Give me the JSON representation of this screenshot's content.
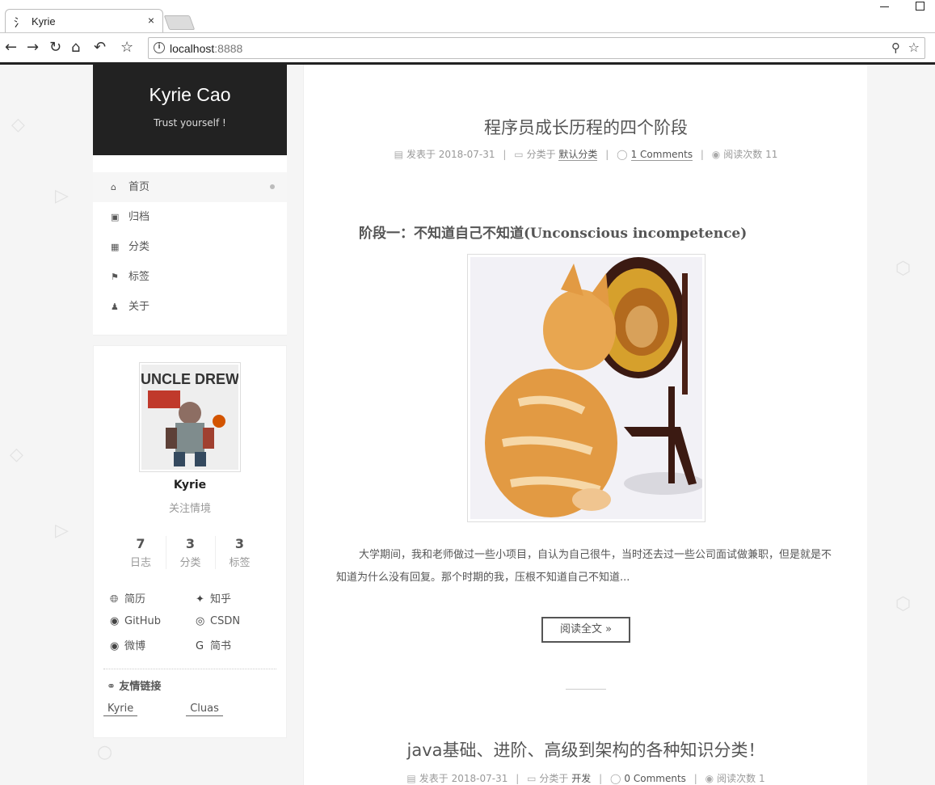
{
  "browser": {
    "tab_title": "Kyrie",
    "favicon_glyph": "氵",
    "close_glyph": "×",
    "url_host": "localhost",
    "url_port": ":8888"
  },
  "site": {
    "title": "Kyrie Cao",
    "subtitle": "Trust yourself !"
  },
  "menu": [
    {
      "icon": "home-icon",
      "label": "首页",
      "active": true
    },
    {
      "icon": "archive-icon",
      "label": "归档",
      "active": false
    },
    {
      "icon": "grid-icon",
      "label": "分类",
      "active": false
    },
    {
      "icon": "tags-icon",
      "label": "标签",
      "active": false
    },
    {
      "icon": "user-icon",
      "label": "关于",
      "active": false
    }
  ],
  "profile": {
    "name": "Kyrie",
    "description": "关注情境",
    "avatar_text": "UNCLE DREW",
    "stats": [
      {
        "num": "7",
        "label": "日志"
      },
      {
        "num": "3",
        "label": "分类"
      },
      {
        "num": "3",
        "label": "标签"
      }
    ],
    "links": [
      {
        "icon": "globe-icon",
        "label": "简历"
      },
      {
        "icon": "twitter-icon",
        "label": "知乎"
      },
      {
        "icon": "github-icon",
        "label": "GitHub"
      },
      {
        "icon": "chrome-icon",
        "label": "CSDN"
      },
      {
        "icon": "weibo-icon",
        "label": "微博"
      },
      {
        "icon": "google-icon",
        "label": "简书"
      }
    ],
    "friends_title": "友情链接",
    "friends": [
      "Kyrie",
      "Cluas"
    ]
  },
  "posts": [
    {
      "title": "程序员成长历程的四个阶段",
      "posted_label": "发表于",
      "date": "2018-07-31",
      "category_label": "分类于",
      "category": "默认分类",
      "comments": "1 Comments",
      "views_label": "阅读次数",
      "views": "11",
      "heading": "阶段一：不知道自己不知道(Unconscious incompetence)",
      "excerpt": "大学期间，我和老师做过一些小项目，自认为自己很牛，当时还去过一些公司面试做兼职，但是就是不知道为什么没有回复。那个时期的我，压根不知道自己不知道...",
      "read_more": "阅读全文 »"
    },
    {
      "title": "java基础、进阶、高级到架构的各种知识分类！",
      "posted_label": "发表于",
      "date": "2018-07-31",
      "category_label": "分类于",
      "category": "开发",
      "comments": "0 Comments",
      "views_label": "阅读次数",
      "views": "1"
    }
  ]
}
